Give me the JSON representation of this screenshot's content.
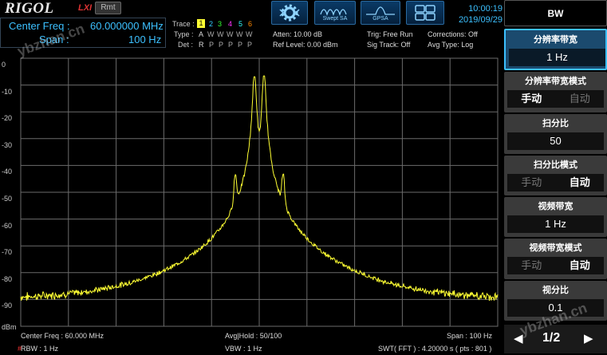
{
  "header": {
    "logo": "RIGOL",
    "lxi": "LXI",
    "rmt": "Rmt",
    "center_freq_label": "Center Freq :",
    "center_freq_value": "60.000000 MHz",
    "span_label": "Span :",
    "span_value": "100 Hz",
    "trace_label": "Trace :",
    "trace_numbers": [
      "1",
      "2",
      "3",
      "4",
      "5",
      "6"
    ],
    "type_label": "Type :",
    "type_values": [
      "A",
      "W",
      "W",
      "W",
      "W",
      "W"
    ],
    "det_label": "Det :",
    "det_values": [
      "R",
      "P",
      "P",
      "P",
      "P",
      "P"
    ],
    "atten": "Atten: 10.00 dB",
    "ref_level": "Ref Level: 0.00 dBm",
    "trig": "Trig: Free Run",
    "sig_track": "Sig Track: Off",
    "corrections": "Corrections: Off",
    "avg_type": "Avg Type: Log",
    "mode_swept": "Swept SA",
    "mode_gpsa": "GPSA",
    "time": "10:00:19",
    "date": "2019/09/29"
  },
  "softkeys": {
    "menu_title": "BW",
    "res_bw_title": "分辨率带宽",
    "res_bw_value": "1 Hz",
    "res_bw_mode_title": "分辨率带宽模式",
    "res_bw_mode_manual": "手动",
    "res_bw_mode_auto": "自动",
    "span_ratio_title": "扫分比",
    "span_ratio_value": "50",
    "span_ratio_mode_title": "扫分比模式",
    "span_ratio_mode_manual": "手动",
    "span_ratio_mode_auto": "自动",
    "vbw_title": "视频带宽",
    "vbw_value": "1 Hz",
    "vbw_mode_title": "视频带宽模式",
    "vbw_mode_manual": "手动",
    "vbw_mode_auto": "自动",
    "vbw_ratio_title": "视分比",
    "vbw_ratio_value": "0.1",
    "page": "1/2"
  },
  "plot": {
    "y_labels": [
      "0",
      "-10",
      "-20",
      "-30",
      "-40",
      "-50",
      "-60",
      "-70",
      "-80",
      "-90"
    ],
    "y_unit": "dBm"
  },
  "footer": {
    "center_freq": "Center Freq : 60.000 MHz",
    "rbw": "RBW : 1 Hz",
    "avg_hold": "Avg|Hold : 50/100",
    "vbw": "VBW : 1 Hz",
    "span": "Span : 100 Hz",
    "swt": "SWT( FFT ) : 4.20000 s ( pts : 801 )"
  },
  "watermark": "ybzhan.cn",
  "colors": {
    "trace": "#ffff33",
    "accent": "#3cc0ff",
    "grid": "#6b6b6b"
  },
  "chart_data": {
    "type": "line",
    "xlim": [
      59.99995,
      60.00005
    ],
    "ylim": [
      -100,
      0
    ],
    "ylabel": "dBm",
    "peaks": [
      {
        "x": 59.9999906,
        "y": -82
      },
      {
        "x": 59.999995,
        "y": -44
      },
      {
        "x": 59.999999,
        "y": -7
      },
      {
        "x": 60.000001,
        "y": -7
      },
      {
        "x": 60.000005,
        "y": -44
      },
      {
        "x": 60.0000094,
        "y": -82
      }
    ],
    "noise_floor": -90.5
  }
}
